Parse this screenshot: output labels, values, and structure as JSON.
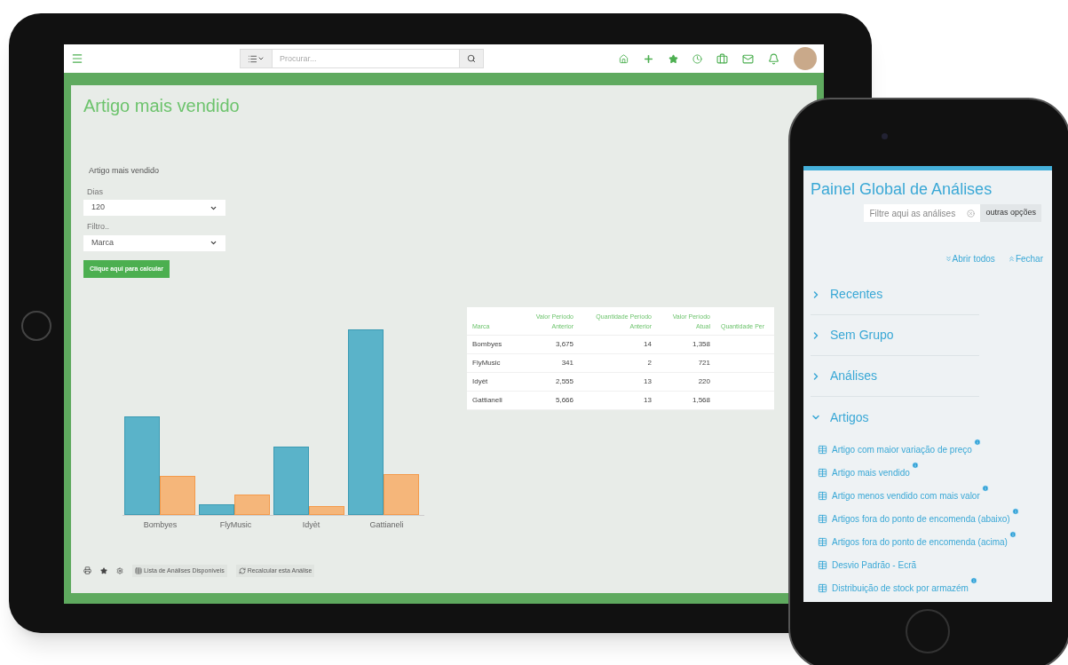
{
  "tablet": {
    "search": {
      "placeholder": "Procurar..."
    },
    "page_title": "Artigo mais vendido",
    "form": {
      "title": "Artigo mais vendido",
      "fields": [
        {
          "label": "Dias",
          "value": "120"
        },
        {
          "label": "Filtro..",
          "value": "Marca"
        }
      ],
      "button": "Clique aqui para calcular"
    },
    "chart": {
      "categories": [
        "Bombyes",
        "FlyMusic",
        "Idyèt",
        "Gattianeli"
      ]
    },
    "table": {
      "columns": [
        "Marca",
        "Valor Período Anterior",
        "Quantidade Período Anterior",
        "Valor Período Atual",
        "Quantidade Per"
      ],
      "rows": [
        [
          "Bombyes",
          "3,675",
          "14",
          "1,358"
        ],
        [
          "FlyMusic",
          "341",
          "2",
          "721"
        ],
        [
          "Idyèt",
          "2,555",
          "13",
          "220"
        ],
        [
          "Gattianeli",
          "5,666",
          "13",
          "1,568"
        ]
      ]
    },
    "toolbar": {
      "links": [
        "Lista de Análises Disponíveis",
        "Recalcular esta Análise"
      ]
    }
  },
  "phone": {
    "title": "Painel Global de Análises",
    "filter": {
      "placeholder": "Filtre aqui as análises"
    },
    "options_button": "outras opções",
    "expand_all": "Abrir todos",
    "collapse_all": "Fechar",
    "groups": [
      {
        "label": "Recentes",
        "expanded": false
      },
      {
        "label": "Sem Grupo",
        "expanded": false
      },
      {
        "label": "Análises",
        "expanded": false
      },
      {
        "label": "Artigos",
        "expanded": true,
        "children": [
          {
            "label": "Artigo com maior variação de preço",
            "info": true
          },
          {
            "label": "Artigo mais vendido",
            "info": true
          },
          {
            "label": "Artigo menos vendido com mais valor",
            "info": true
          },
          {
            "label": "Artigos fora do ponto de encomenda (abaixo)",
            "info": true
          },
          {
            "label": "Artigos fora do ponto de encomenda (acima)",
            "info": true
          },
          {
            "label": "Desvio Padrão - Ecrã",
            "info": false
          },
          {
            "label": "Distribuição de stock por armazém",
            "info": true
          }
        ]
      }
    ]
  }
}
